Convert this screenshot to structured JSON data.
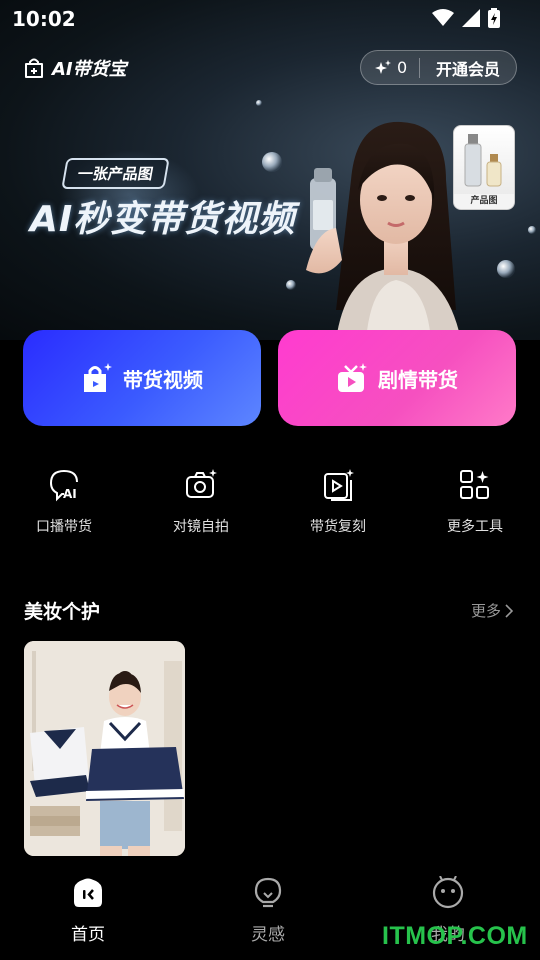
{
  "status_bar": {
    "time": "10:02"
  },
  "header": {
    "app_name": "AI带货宝",
    "points": "0",
    "vip_label": "开通会员"
  },
  "banner": {
    "tag": "一张产品图",
    "headline": "AI秒变带货视频",
    "product_label": "产品图"
  },
  "actions": {
    "goods_video": "带货视频",
    "plot_goods": "剧情带货"
  },
  "tools": [
    {
      "label": "口播带货",
      "icon": "ai-speech-icon"
    },
    {
      "label": "对镜自拍",
      "icon": "camera-icon"
    },
    {
      "label": "带货复刻",
      "icon": "video-copy-icon"
    },
    {
      "label": "更多工具",
      "icon": "grid-icon"
    }
  ],
  "section": {
    "title": "美妆个护",
    "more": "更多"
  },
  "tabbar": [
    {
      "label": "首页",
      "icon": "home-icon",
      "active": true
    },
    {
      "label": "灵感",
      "icon": "bulb-icon",
      "active": false
    },
    {
      "label": "我的",
      "icon": "profile-icon",
      "active": false
    }
  ],
  "watermark": "ITMOP.COM",
  "colors": {
    "goods_btn": "#3b5bff",
    "plot_btn": "#f650c0",
    "watermark": "#27c24c"
  }
}
